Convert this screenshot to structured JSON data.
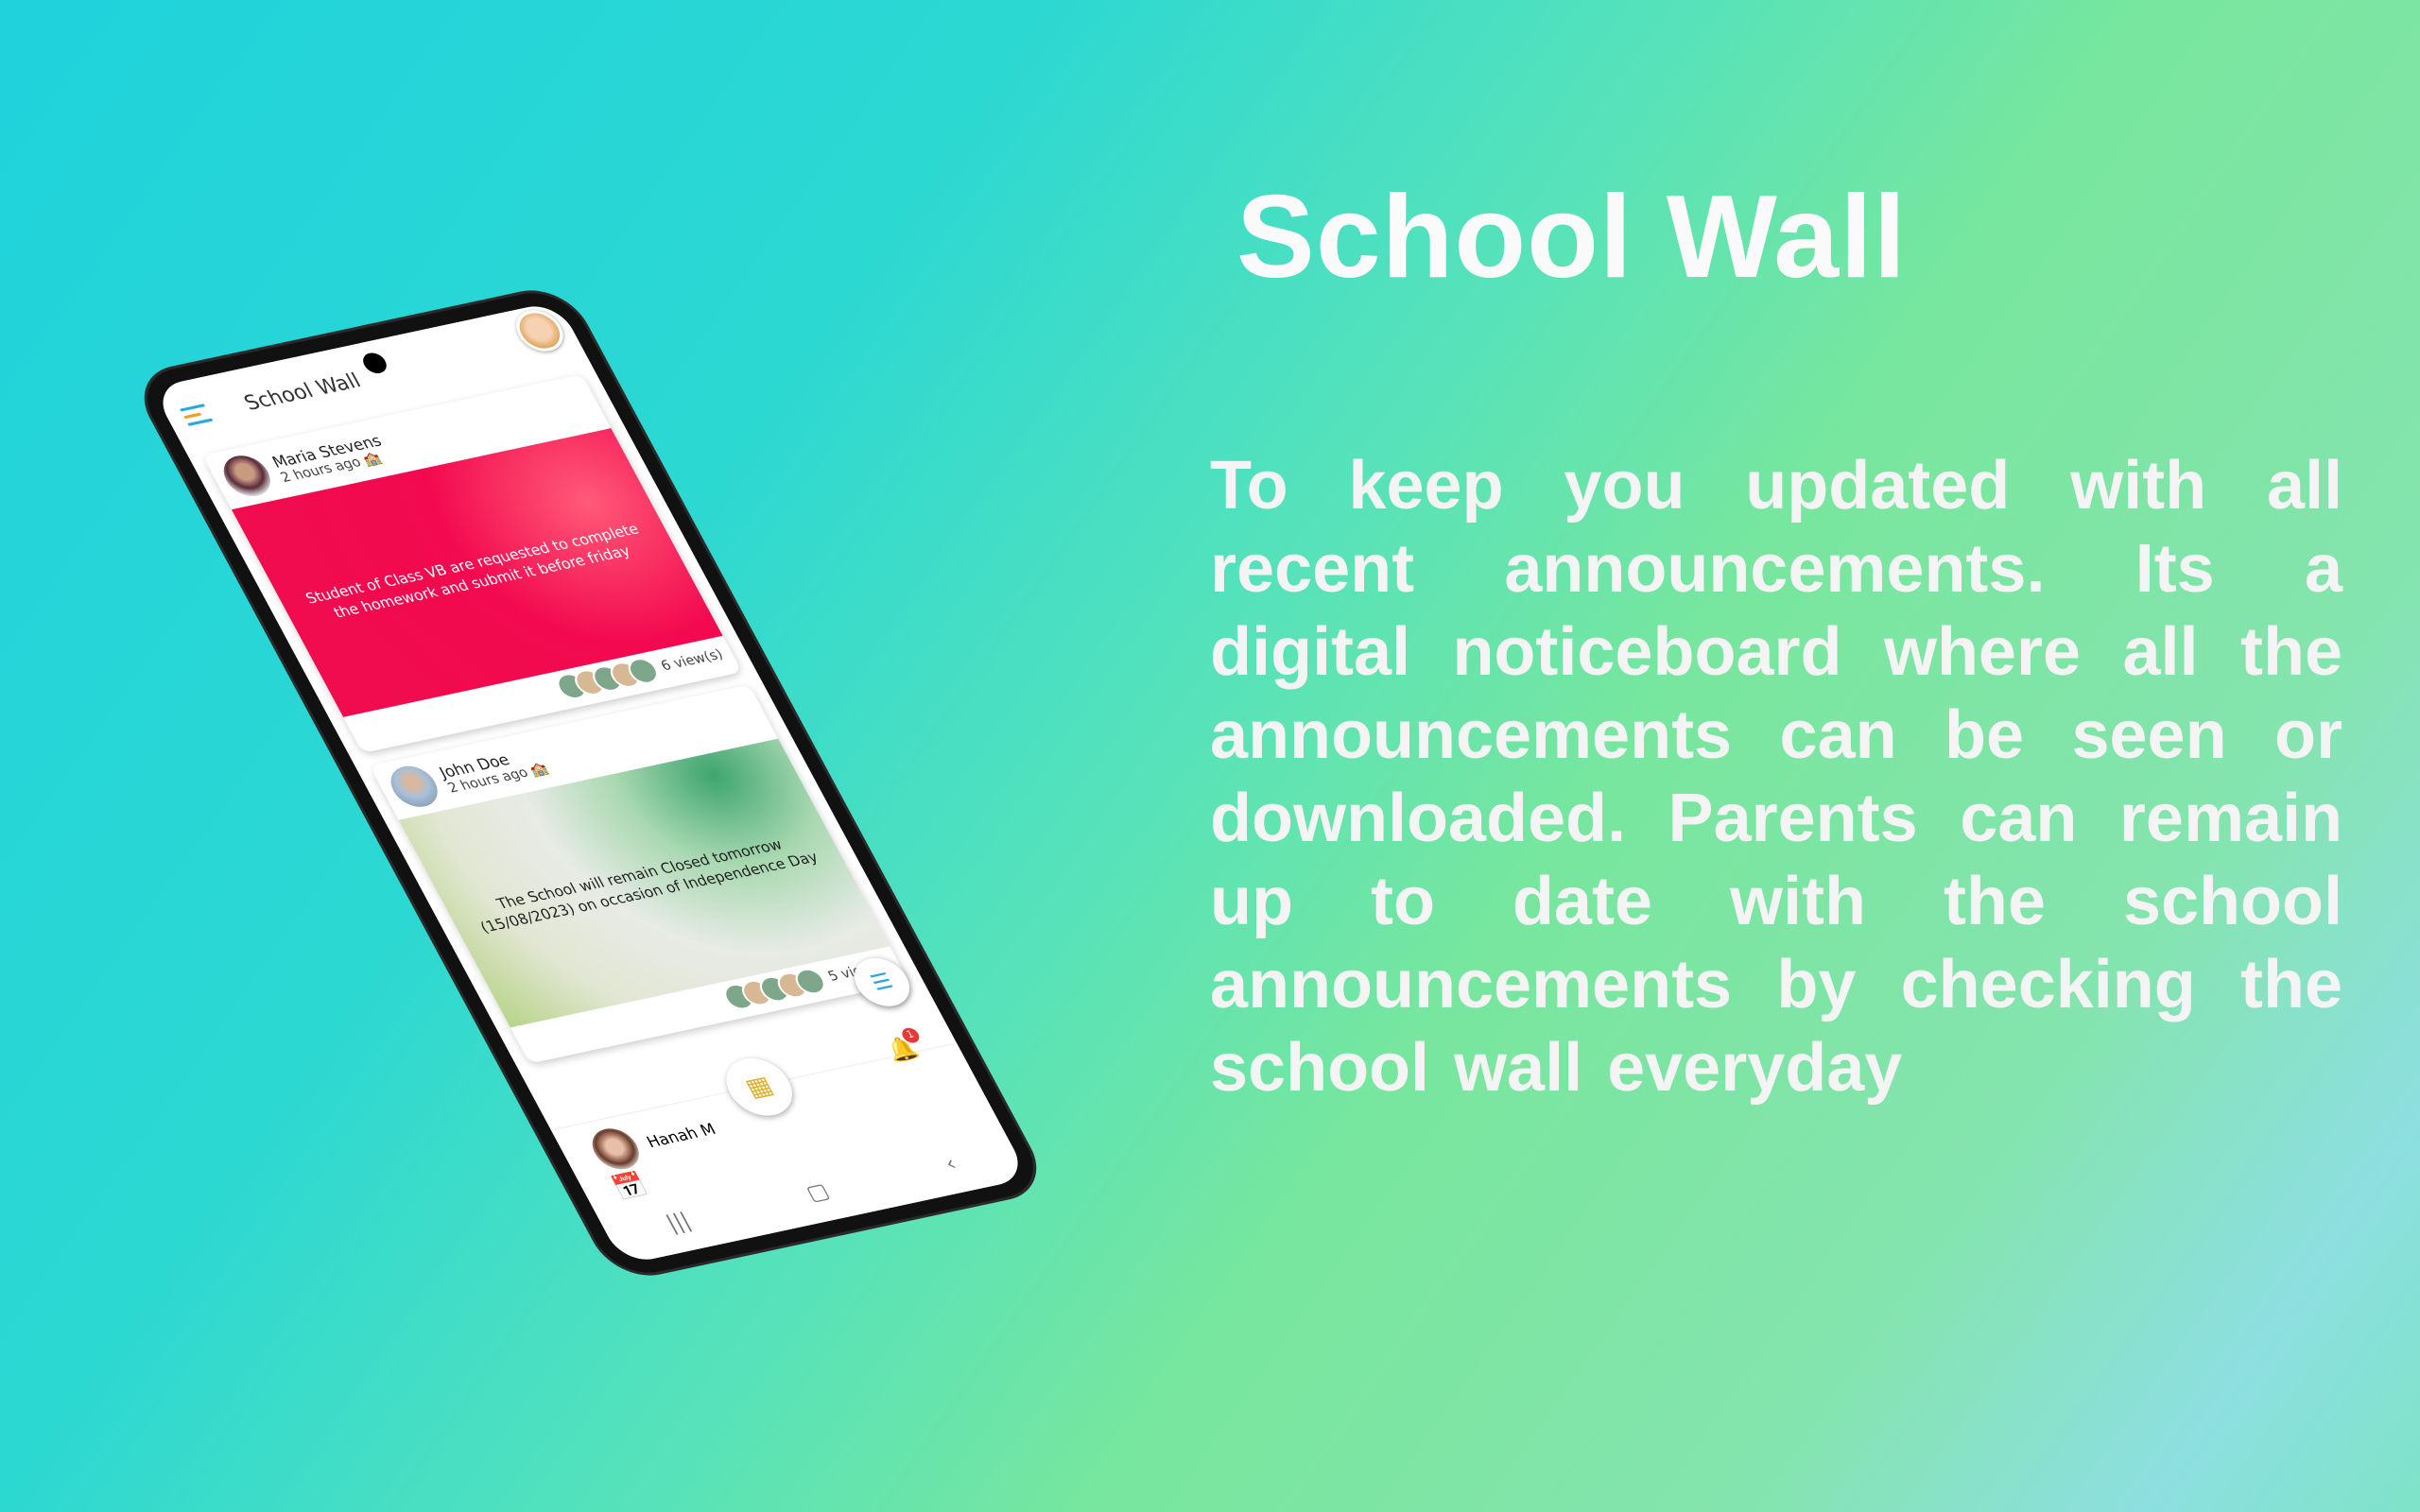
{
  "headline": "School Wall",
  "description": "To keep you updated with all recent announcements. Its a digital noticeboard where all the announcements can be seen or downloaded. Parents can remain up to date with the school announcements by checking the school wall everyday",
  "app": {
    "title": "School Wall",
    "posts": [
      {
        "author": "Maria Stevens",
        "time": "2 hours ago",
        "message": "Student of Class VB are requested to complete the homework and submit it before friday",
        "views": "6 view(s)"
      },
      {
        "author": "John Doe",
        "time": "2 hours ago",
        "message": "The School will remain Closed tomorrow (15/08/2023) on occasion of Independence Day",
        "views": "5 view(s)"
      },
      {
        "author": "Hanah M"
      }
    ],
    "notification_count": "1"
  },
  "colors": {
    "accent_blue": "#2aa7e0",
    "accent_orange": "#f0a020",
    "post1_bg": "#ef0d4e"
  }
}
